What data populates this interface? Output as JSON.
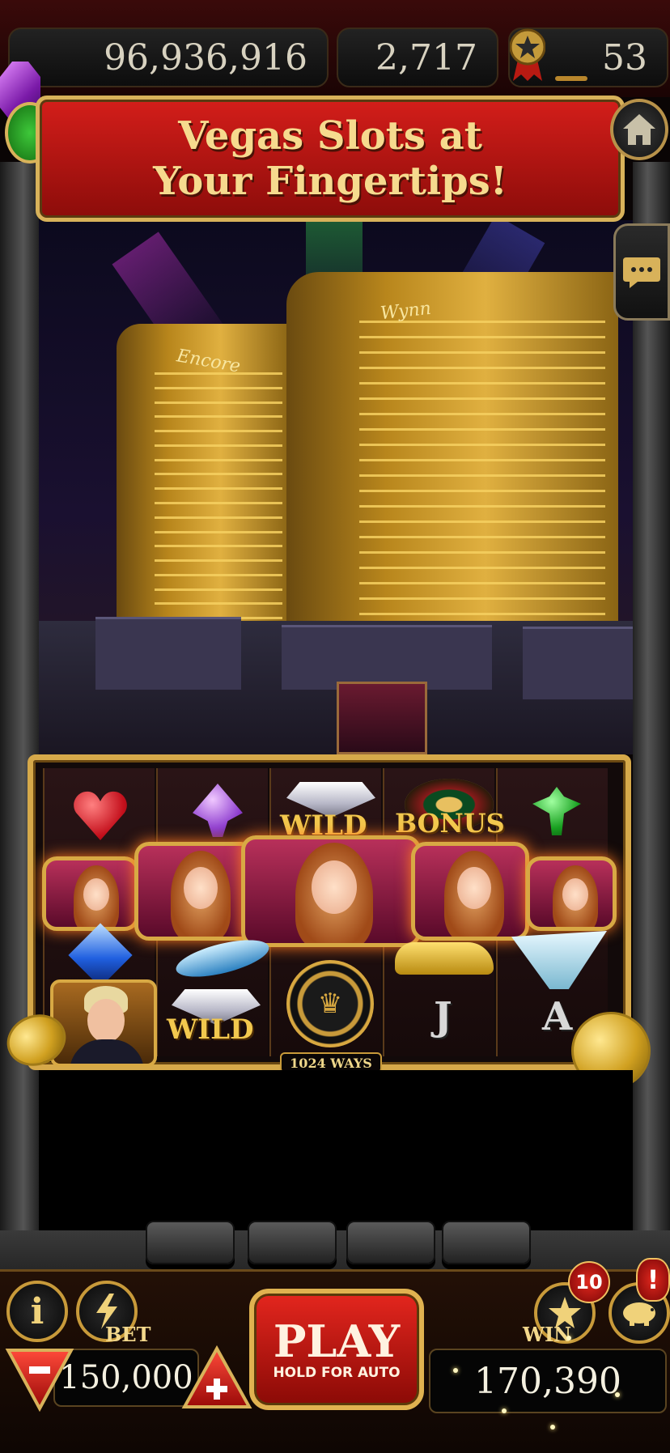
{
  "header": {
    "coins": "96,936,916",
    "gems": "2,717",
    "level": "53",
    "icons": [
      "coin-icon",
      "gem-icon",
      "star-medal-icon",
      "home-icon",
      "chat-icon"
    ]
  },
  "banner": {
    "line1": "Vegas Slots at",
    "line2": "Your Fingertips!"
  },
  "scene": {
    "tower_left_sign": "Encore",
    "tower_right_sign": "Wynn"
  },
  "reels": {
    "wild_label": "WILD",
    "bonus_label": "BONUS",
    "letter_j": "J",
    "letter_a": "A",
    "ways_label": "1024 WAYS",
    "symbols": [
      "heart",
      "purple-spade-gem",
      "wild-diamond",
      "bonus-roulette",
      "green-clover",
      "blue-diamond",
      "woman",
      "man",
      "wild-diamond",
      "chip",
      "gold-car",
      "yacht",
      "j",
      "a"
    ]
  },
  "controls": {
    "info_label": "i",
    "bet_label": "BET",
    "bet_value": "150,000",
    "play_label": "PLAY",
    "play_sub": "HOLD FOR AUTO",
    "win_label": "WIN",
    "win_value": "170,390",
    "star_badge": "10",
    "piggy_badge": "!"
  },
  "colors": {
    "gold": "#d8b25a",
    "red": "#d41e1a",
    "banner_text": "#f6da8e",
    "play_red": "#e4261e"
  }
}
